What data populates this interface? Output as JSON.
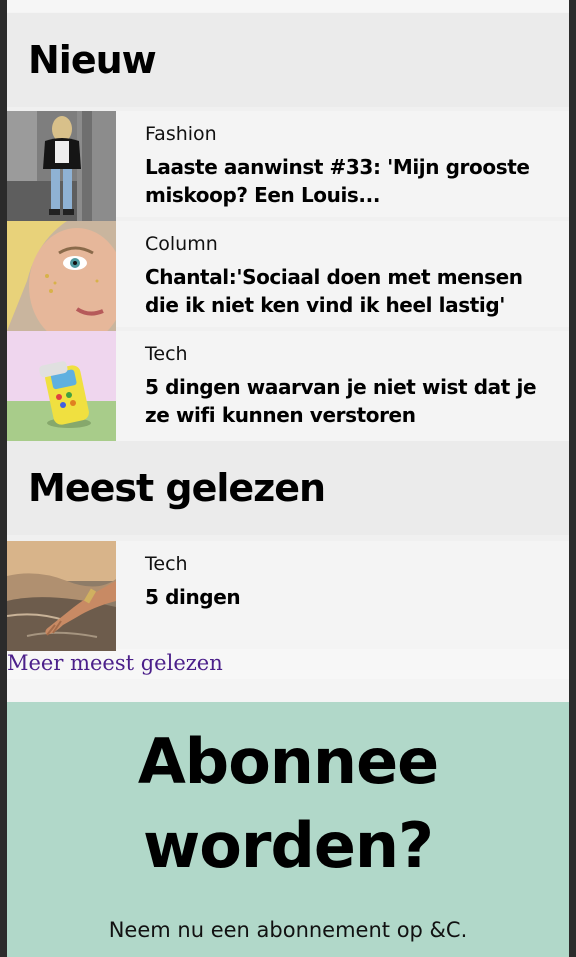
{
  "sections": {
    "new": {
      "heading": "Nieuw",
      "articles": [
        {
          "category": "Fashion",
          "title": "Laaste aanwinst #33: 'Mijn grooste miskoop? Een Louis..."
        },
        {
          "category": "Column",
          "title": "Chantal:'Sociaal doen met mensen die ik niet ken vind ik heel lastig'"
        },
        {
          "category": "Tech",
          "title": "5 dingen waarvan je niet wist dat je ze wifi kunnen verstoren"
        }
      ]
    },
    "most_read": {
      "heading": "Meest gelezen",
      "articles": [
        {
          "category": "Tech",
          "title": "5 dingen"
        }
      ],
      "more_link": "Meer meest gelezen"
    }
  },
  "subscribe": {
    "title": "Abonnee worden?",
    "text": "Neem nu een abonnement op &C."
  },
  "icons": {
    "thumb_fashion": "photo-woman-black-jacket",
    "thumb_column": "photo-woman-face-glitter",
    "thumb_tech": "photo-toy-phone",
    "thumb_most_read": "photo-hand-in-water"
  },
  "colors": {
    "subscribe_bg": "#b1d8c9",
    "link": "#4b1f8a",
    "heading_bg": "#ebebeb"
  }
}
